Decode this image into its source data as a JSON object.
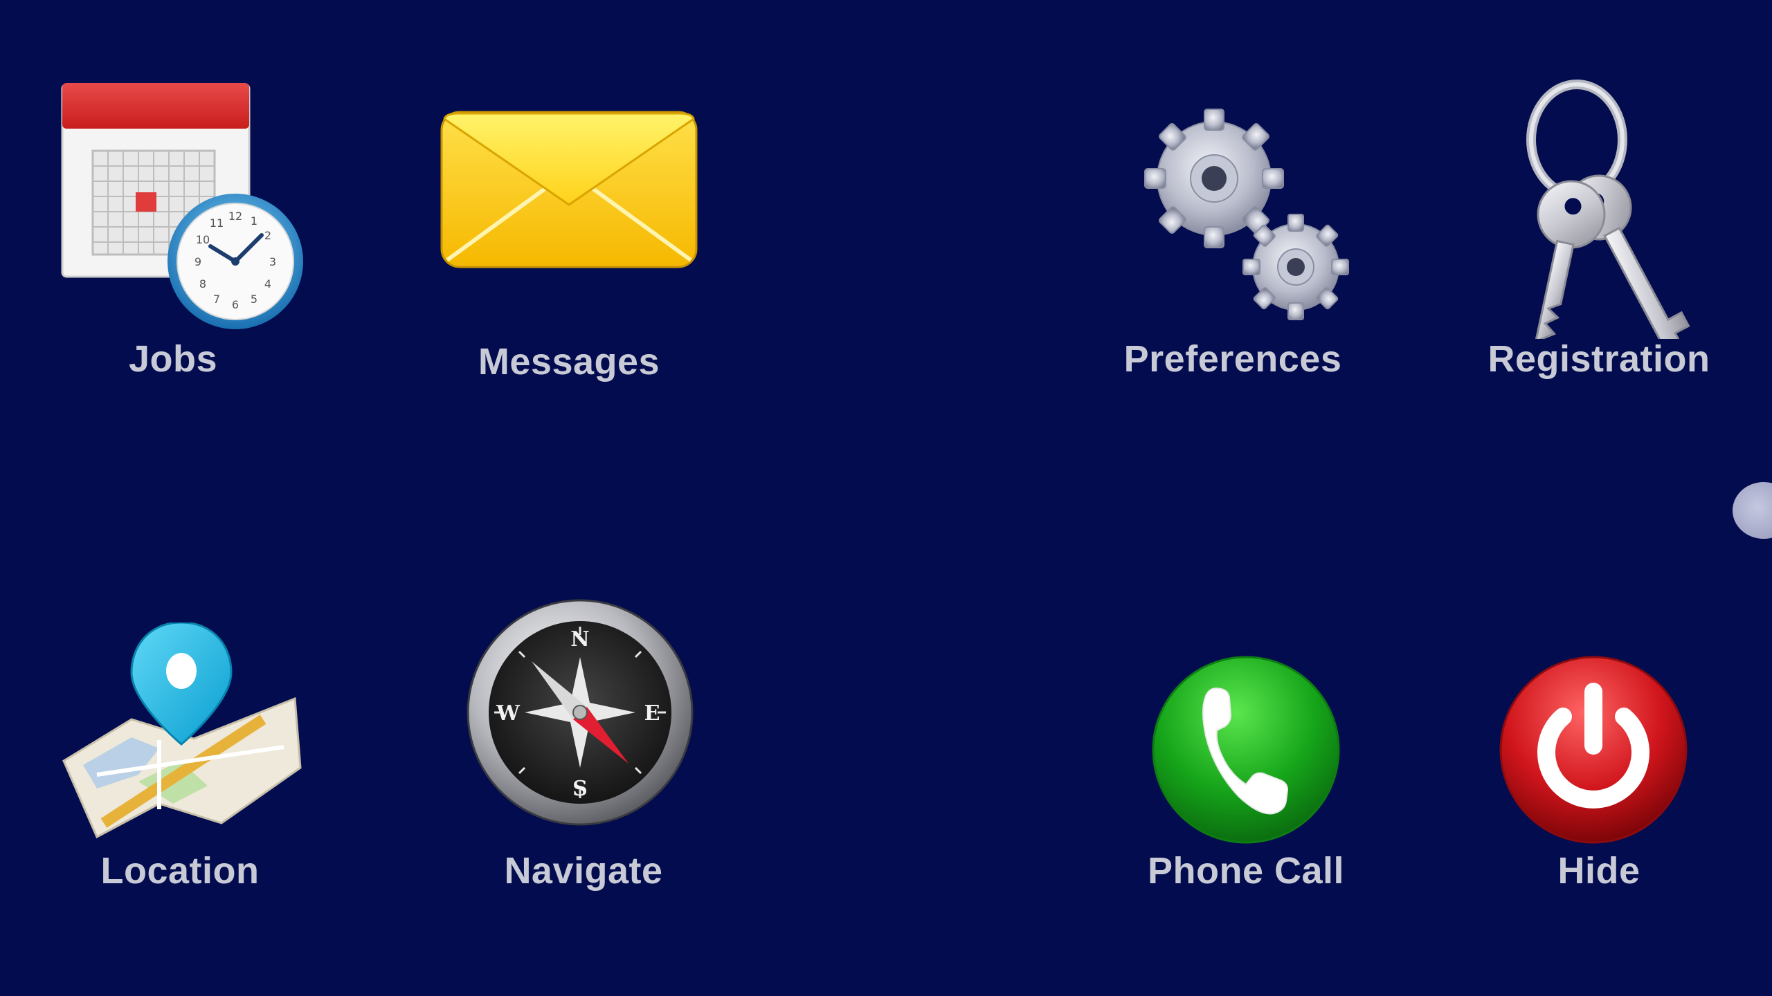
{
  "tiles": {
    "jobs": {
      "label": "Jobs",
      "icon": "calendar-clock-icon"
    },
    "messages": {
      "label": "Messages",
      "icon": "envelope-icon"
    },
    "preferences": {
      "label": "Preferences",
      "icon": "gears-icon"
    },
    "registration": {
      "label": "Registration",
      "icon": "keys-icon"
    },
    "location": {
      "label": "Location",
      "icon": "map-pin-icon"
    },
    "navigate": {
      "label": "Navigate",
      "icon": "compass-icon"
    },
    "phone_call": {
      "label": "Phone Call",
      "icon": "phone-icon"
    },
    "hide": {
      "label": "Hide",
      "icon": "power-icon"
    }
  },
  "compass": {
    "n": "N",
    "e": "E",
    "s": "S",
    "w": "W"
  },
  "clock": {
    "numbers": [
      "12",
      "1",
      "2",
      "3",
      "4",
      "5",
      "6",
      "7",
      "8",
      "9",
      "10",
      "11"
    ]
  },
  "colors": {
    "background": "#020c4e",
    "label": "#c8cad6"
  }
}
